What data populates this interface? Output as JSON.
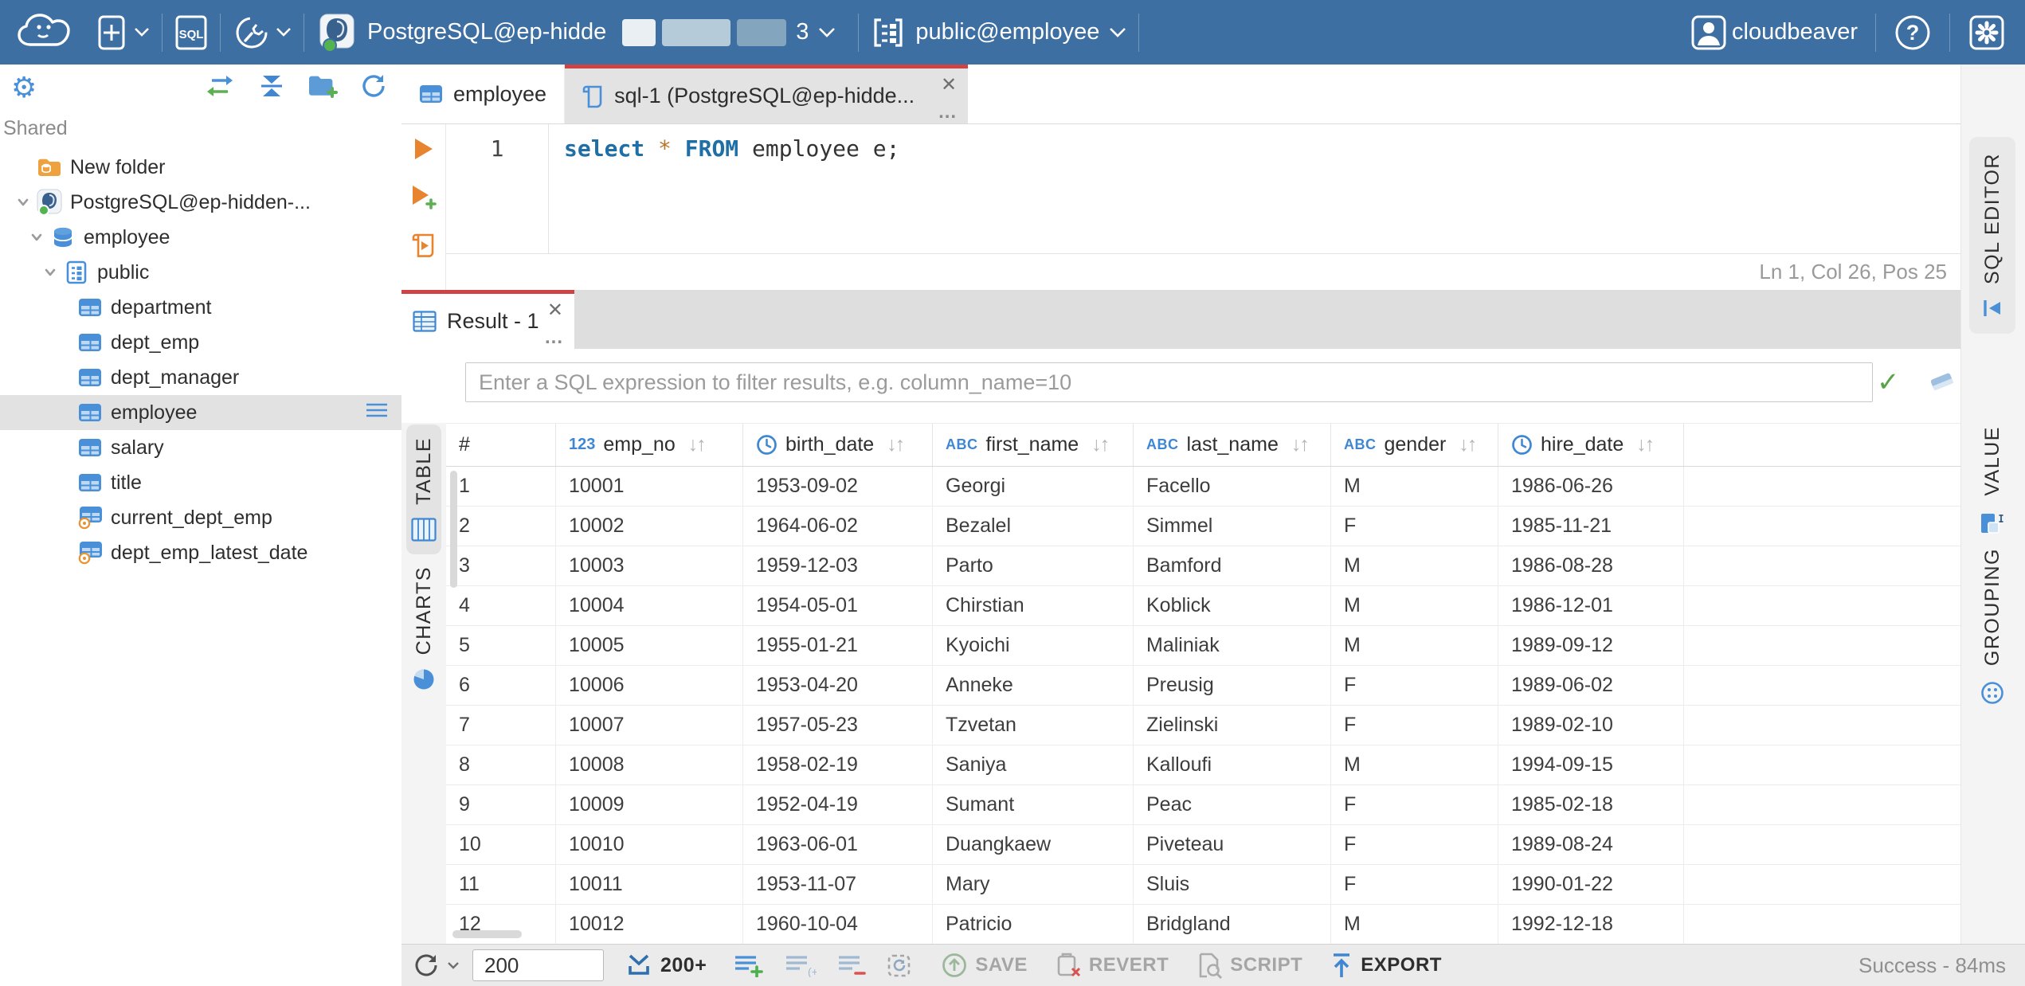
{
  "topbar": {
    "sql_badge": "SQL",
    "connection_label": "PostgreSQL@ep-hidde",
    "connection_suffix": "3",
    "schema_label": "public@employee",
    "user_label": "cloudbeaver",
    "help_label": "?"
  },
  "sidebar": {
    "section_label": "Shared",
    "tree": [
      {
        "label": "New folder",
        "icon": "folder",
        "indent": 0,
        "chevron": false,
        "selected": false
      },
      {
        "label": "PostgreSQL@ep-hidden-...",
        "icon": "postgres",
        "indent": 0,
        "chevron": true,
        "selected": false
      },
      {
        "label": "employee",
        "icon": "database",
        "indent": 1,
        "chevron": true,
        "selected": false
      },
      {
        "label": "public",
        "icon": "schema",
        "indent": 2,
        "chevron": true,
        "selected": false
      },
      {
        "label": "department",
        "icon": "table",
        "indent": 3,
        "chevron": false,
        "selected": false
      },
      {
        "label": "dept_emp",
        "icon": "table",
        "indent": 3,
        "chevron": false,
        "selected": false
      },
      {
        "label": "dept_manager",
        "icon": "table",
        "indent": 3,
        "chevron": false,
        "selected": false
      },
      {
        "label": "employee",
        "icon": "table",
        "indent": 3,
        "chevron": false,
        "selected": true
      },
      {
        "label": "salary",
        "icon": "table",
        "indent": 3,
        "chevron": false,
        "selected": false
      },
      {
        "label": "title",
        "icon": "table",
        "indent": 3,
        "chevron": false,
        "selected": false
      },
      {
        "label": "current_dept_emp",
        "icon": "view",
        "indent": 3,
        "chevron": false,
        "selected": false
      },
      {
        "label": "dept_emp_latest_date",
        "icon": "view",
        "indent": 3,
        "chevron": false,
        "selected": false
      }
    ]
  },
  "editor": {
    "tabs": [
      {
        "label": "employee"
      },
      {
        "label": "sql-1 (PostgreSQL@ep-hidde..."
      }
    ],
    "line_number": "1",
    "sql": {
      "kw1": "select",
      "star": "*",
      "kw2": "FROM",
      "rest": " employee e;"
    },
    "status": "Ln 1, Col 26, Pos 25",
    "side_tab": "SQL EDITOR"
  },
  "result": {
    "tab_label": "Result - 1",
    "filter_placeholder": "Enter a SQL expression to filter results, e.g. column_name=10",
    "left_tabs": [
      {
        "label": "TABLE"
      },
      {
        "label": "CHARTS"
      }
    ],
    "right_tabs": [
      {
        "label": "VALUE"
      },
      {
        "label": "GROUPING"
      }
    ]
  },
  "grid": {
    "columns": [
      {
        "name": "#",
        "type": null
      },
      {
        "name": "emp_no",
        "type": "number"
      },
      {
        "name": "birth_date",
        "type": "date"
      },
      {
        "name": "first_name",
        "type": "string"
      },
      {
        "name": "last_name",
        "type": "string"
      },
      {
        "name": "gender",
        "type": "string"
      },
      {
        "name": "hire_date",
        "type": "date"
      }
    ],
    "rows": [
      [
        "1",
        "10001",
        "1953-09-02",
        "Georgi",
        "Facello",
        "M",
        "1986-06-26"
      ],
      [
        "2",
        "10002",
        "1964-06-02",
        "Bezalel",
        "Simmel",
        "F",
        "1985-11-21"
      ],
      [
        "3",
        "10003",
        "1959-12-03",
        "Parto",
        "Bamford",
        "M",
        "1986-08-28"
      ],
      [
        "4",
        "10004",
        "1954-05-01",
        "Chirstian",
        "Koblick",
        "M",
        "1986-12-01"
      ],
      [
        "5",
        "10005",
        "1955-01-21",
        "Kyoichi",
        "Maliniak",
        "M",
        "1989-09-12"
      ],
      [
        "6",
        "10006",
        "1953-04-20",
        "Anneke",
        "Preusig",
        "F",
        "1989-06-02"
      ],
      [
        "7",
        "10007",
        "1957-05-23",
        "Tzvetan",
        "Zielinski",
        "F",
        "1989-02-10"
      ],
      [
        "8",
        "10008",
        "1958-02-19",
        "Saniya",
        "Kalloufi",
        "M",
        "1994-09-15"
      ],
      [
        "9",
        "10009",
        "1952-04-19",
        "Sumant",
        "Peac",
        "F",
        "1985-02-18"
      ],
      [
        "10",
        "10010",
        "1963-06-01",
        "Duangkaew",
        "Piveteau",
        "F",
        "1989-08-24"
      ],
      [
        "11",
        "10011",
        "1953-11-07",
        "Mary",
        "Sluis",
        "F",
        "1990-01-22"
      ],
      [
        "12",
        "10012",
        "1960-10-04",
        "Patricio",
        "Bridgland",
        "M",
        "1992-12-18"
      ]
    ]
  },
  "toolbar": {
    "row_limit": "200",
    "fetch_label": "200+",
    "save_label": "SAVE",
    "revert_label": "REVERT",
    "script_label": "SCRIPT",
    "export_label": "EXPORT",
    "status": "Success - 84ms"
  },
  "ui": {
    "close": "✕",
    "more": "...",
    "sort": "↓↑",
    "check": "✓",
    "num_type": "123",
    "str_type": "ABC"
  },
  "colors": {
    "topbar_blue": "#3d6fa2",
    "accent_red": "#ce4444",
    "accent_blue": "#4a90d9",
    "exec_orange": "#e8842e",
    "success_green": "#54b351"
  }
}
